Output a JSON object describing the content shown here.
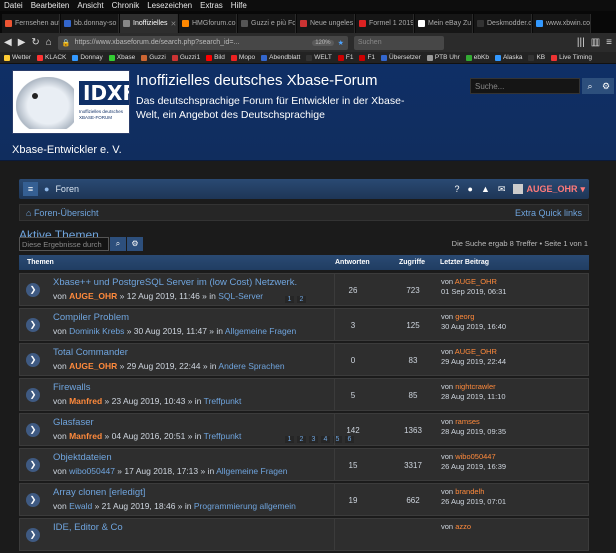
{
  "os_menu": [
    "Datei",
    "Bearbeiten",
    "Ansicht",
    "Chronik",
    "Lesezeichen",
    "Extras",
    "Hilfe"
  ],
  "browser_tabs": [
    {
      "label": "Fernsehen auf"
    },
    {
      "label": "bb.donnay-so"
    },
    {
      "label": "Inoffizielles",
      "active": true
    },
    {
      "label": "HMGforum.co"
    },
    {
      "label": "Guzzi e più Forum"
    },
    {
      "label": "Neue ungeles"
    },
    {
      "label": "Formel 1 2019"
    },
    {
      "label": "Mein eBay Zu"
    },
    {
      "label": "Deskmodder.c"
    },
    {
      "label": "www.xbwin.co"
    }
  ],
  "url": "https://www.xbaseforum.de/search.php?search_id=...",
  "zoom": "120%",
  "browser_search_placeholder": "Suchen",
  "bookmarks": [
    "Wetter",
    "KLACK",
    "Donnay",
    "Xbase",
    "Guzzi",
    "Guzzi1",
    "Bild",
    "Mopo",
    "Abendblatt",
    "WELT",
    "F1",
    "F1",
    "Übersetzer",
    "PTB Uhr",
    "ebKb",
    "Alaska",
    "KB",
    "Live Timing"
  ],
  "header": {
    "logo_text": "IDXF",
    "logo_small": "Inoffizielles deutsches XBASE-FORUM",
    "site_name": "Xbase-Entwickler e. V.",
    "title": "Inoffizielles deutsches Xbase-Forum",
    "description": "Das deutschsprachige Forum für Entwickler in der Xbase-Welt, ein Angebot des Deutschsprachige",
    "search_placeholder": "Suche..."
  },
  "nav": {
    "forums_label": "Foren",
    "username": "AUGE_OHR"
  },
  "breadcrumb": {
    "home": "Foren-Übersicht",
    "quicklinks": "Extra Quick links"
  },
  "page": {
    "title": "Aktive Themen",
    "advanced_link": "Zur erweiterten Suche",
    "filter_placeholder": "Diese Ergebnisse durch",
    "result_count": "Die Suche ergab 8 Treffer • Seite 1 von 1"
  },
  "columns": {
    "topics": "Themen",
    "replies": "Antworten",
    "views": "Zugriffe",
    "last_post": "Letzter Beitrag"
  },
  "topics": [
    {
      "title": "Xbase++ und PostgreSQL Server im (low Cost) Netzwerk.",
      "author": "AUGE_OHR",
      "author_type": "o",
      "date": "12 Aug 2019, 11:46",
      "forum": "SQL-Server",
      "replies": "26",
      "views": "723",
      "last_by": "AUGE_OHR",
      "last_date": "01 Sep 2019, 06:31",
      "pages": [
        "1",
        "2"
      ]
    },
    {
      "title": "Compiler Problem",
      "author": "Dominik Krebs",
      "author_type": "a",
      "date": "30 Aug 2019, 11:47",
      "forum": "Allgemeine Fragen",
      "replies": "3",
      "views": "125",
      "last_by": "georg",
      "last_date": "30 Aug 2019, 16:40",
      "pages": []
    },
    {
      "title": "Total Commander",
      "author": "AUGE_OHR",
      "author_type": "o",
      "date": "29 Aug 2019, 22:44",
      "forum": "Andere Sprachen",
      "replies": "0",
      "views": "83",
      "last_by": "AUGE_OHR",
      "last_date": "29 Aug 2019, 22:44",
      "pages": []
    },
    {
      "title": "Firewalls",
      "author": "Manfred",
      "author_type": "o",
      "date": "23 Aug 2019, 10:43",
      "forum": "Treffpunkt",
      "replies": "5",
      "views": "85",
      "last_by": "nightcrawler",
      "last_date": "28 Aug 2019, 11:10",
      "pages": []
    },
    {
      "title": "Glasfaser",
      "author": "Manfred",
      "author_type": "o",
      "date": "04 Aug 2016, 20:51",
      "forum": "Treffpunkt",
      "replies": "142",
      "views": "1363",
      "last_by": "ramses",
      "last_date": "28 Aug 2019, 09:35",
      "pages": [
        "1",
        "2",
        "3",
        "4",
        "5",
        "6"
      ]
    },
    {
      "title": "Objektdateien",
      "author": "wibo050447",
      "author_type": "a",
      "date": "17 Aug 2018, 17:13",
      "forum": "Allgemeine Fragen",
      "replies": "15",
      "views": "3317",
      "last_by": "wibo050447",
      "last_date": "26 Aug 2019, 16:39",
      "pages": []
    },
    {
      "title": "Array clonen [erledigt]",
      "author": "Ewald",
      "author_type": "a",
      "date": "21 Aug 2019, 18:46",
      "forum": "Programmierung allgemein",
      "replies": "19",
      "views": "662",
      "last_by": "brandelh",
      "last_date": "26 Aug 2019, 07:01",
      "pages": []
    },
    {
      "title": "IDE, Editor & Co",
      "author": "",
      "author_type": "a",
      "date": "",
      "forum": "",
      "replies": "",
      "views": "",
      "last_by": "azzo",
      "last_date": "",
      "pages": []
    }
  ],
  "labels": {
    "by": "von",
    "in": "in"
  }
}
